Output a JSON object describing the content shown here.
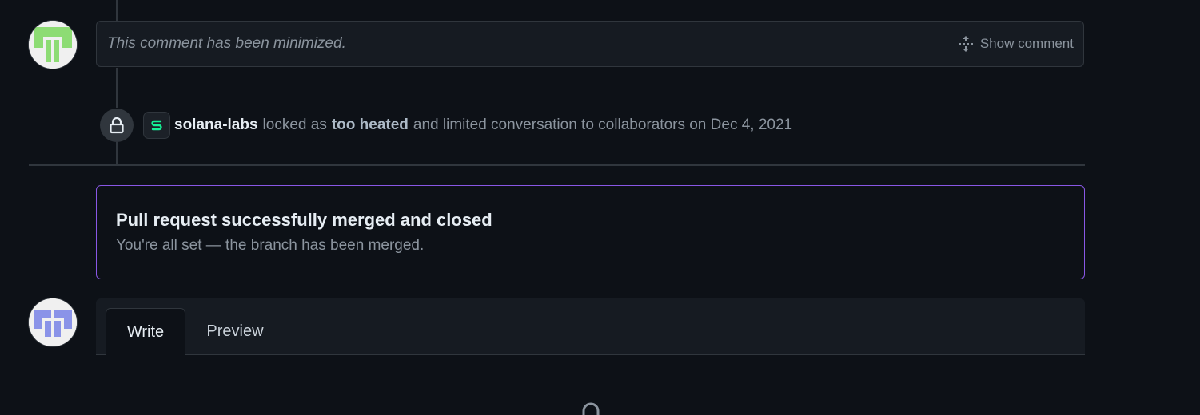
{
  "minimized_comment": {
    "text": "This comment has been minimized.",
    "show_label": "Show comment"
  },
  "lock_event": {
    "org": "solana-labs",
    "text_before": "locked as",
    "reason": "too heated",
    "text_after": "and limited conversation to collaborators on Dec 4, 2021"
  },
  "merged": {
    "title": "Pull request successfully merged and closed",
    "subtitle": "You're all set — the branch has been merged."
  },
  "editor": {
    "tabs": [
      "Write",
      "Preview"
    ],
    "active_tab": "Write"
  },
  "icons": {
    "expand": "unfold-icon",
    "lock": "lock-icon",
    "org_logo": "solana-logo-icon"
  },
  "colors": {
    "background": "#0d1117",
    "merged_border": "#8957e5",
    "avatar1": "#8ddc74",
    "avatar2": "#8a93e8"
  }
}
